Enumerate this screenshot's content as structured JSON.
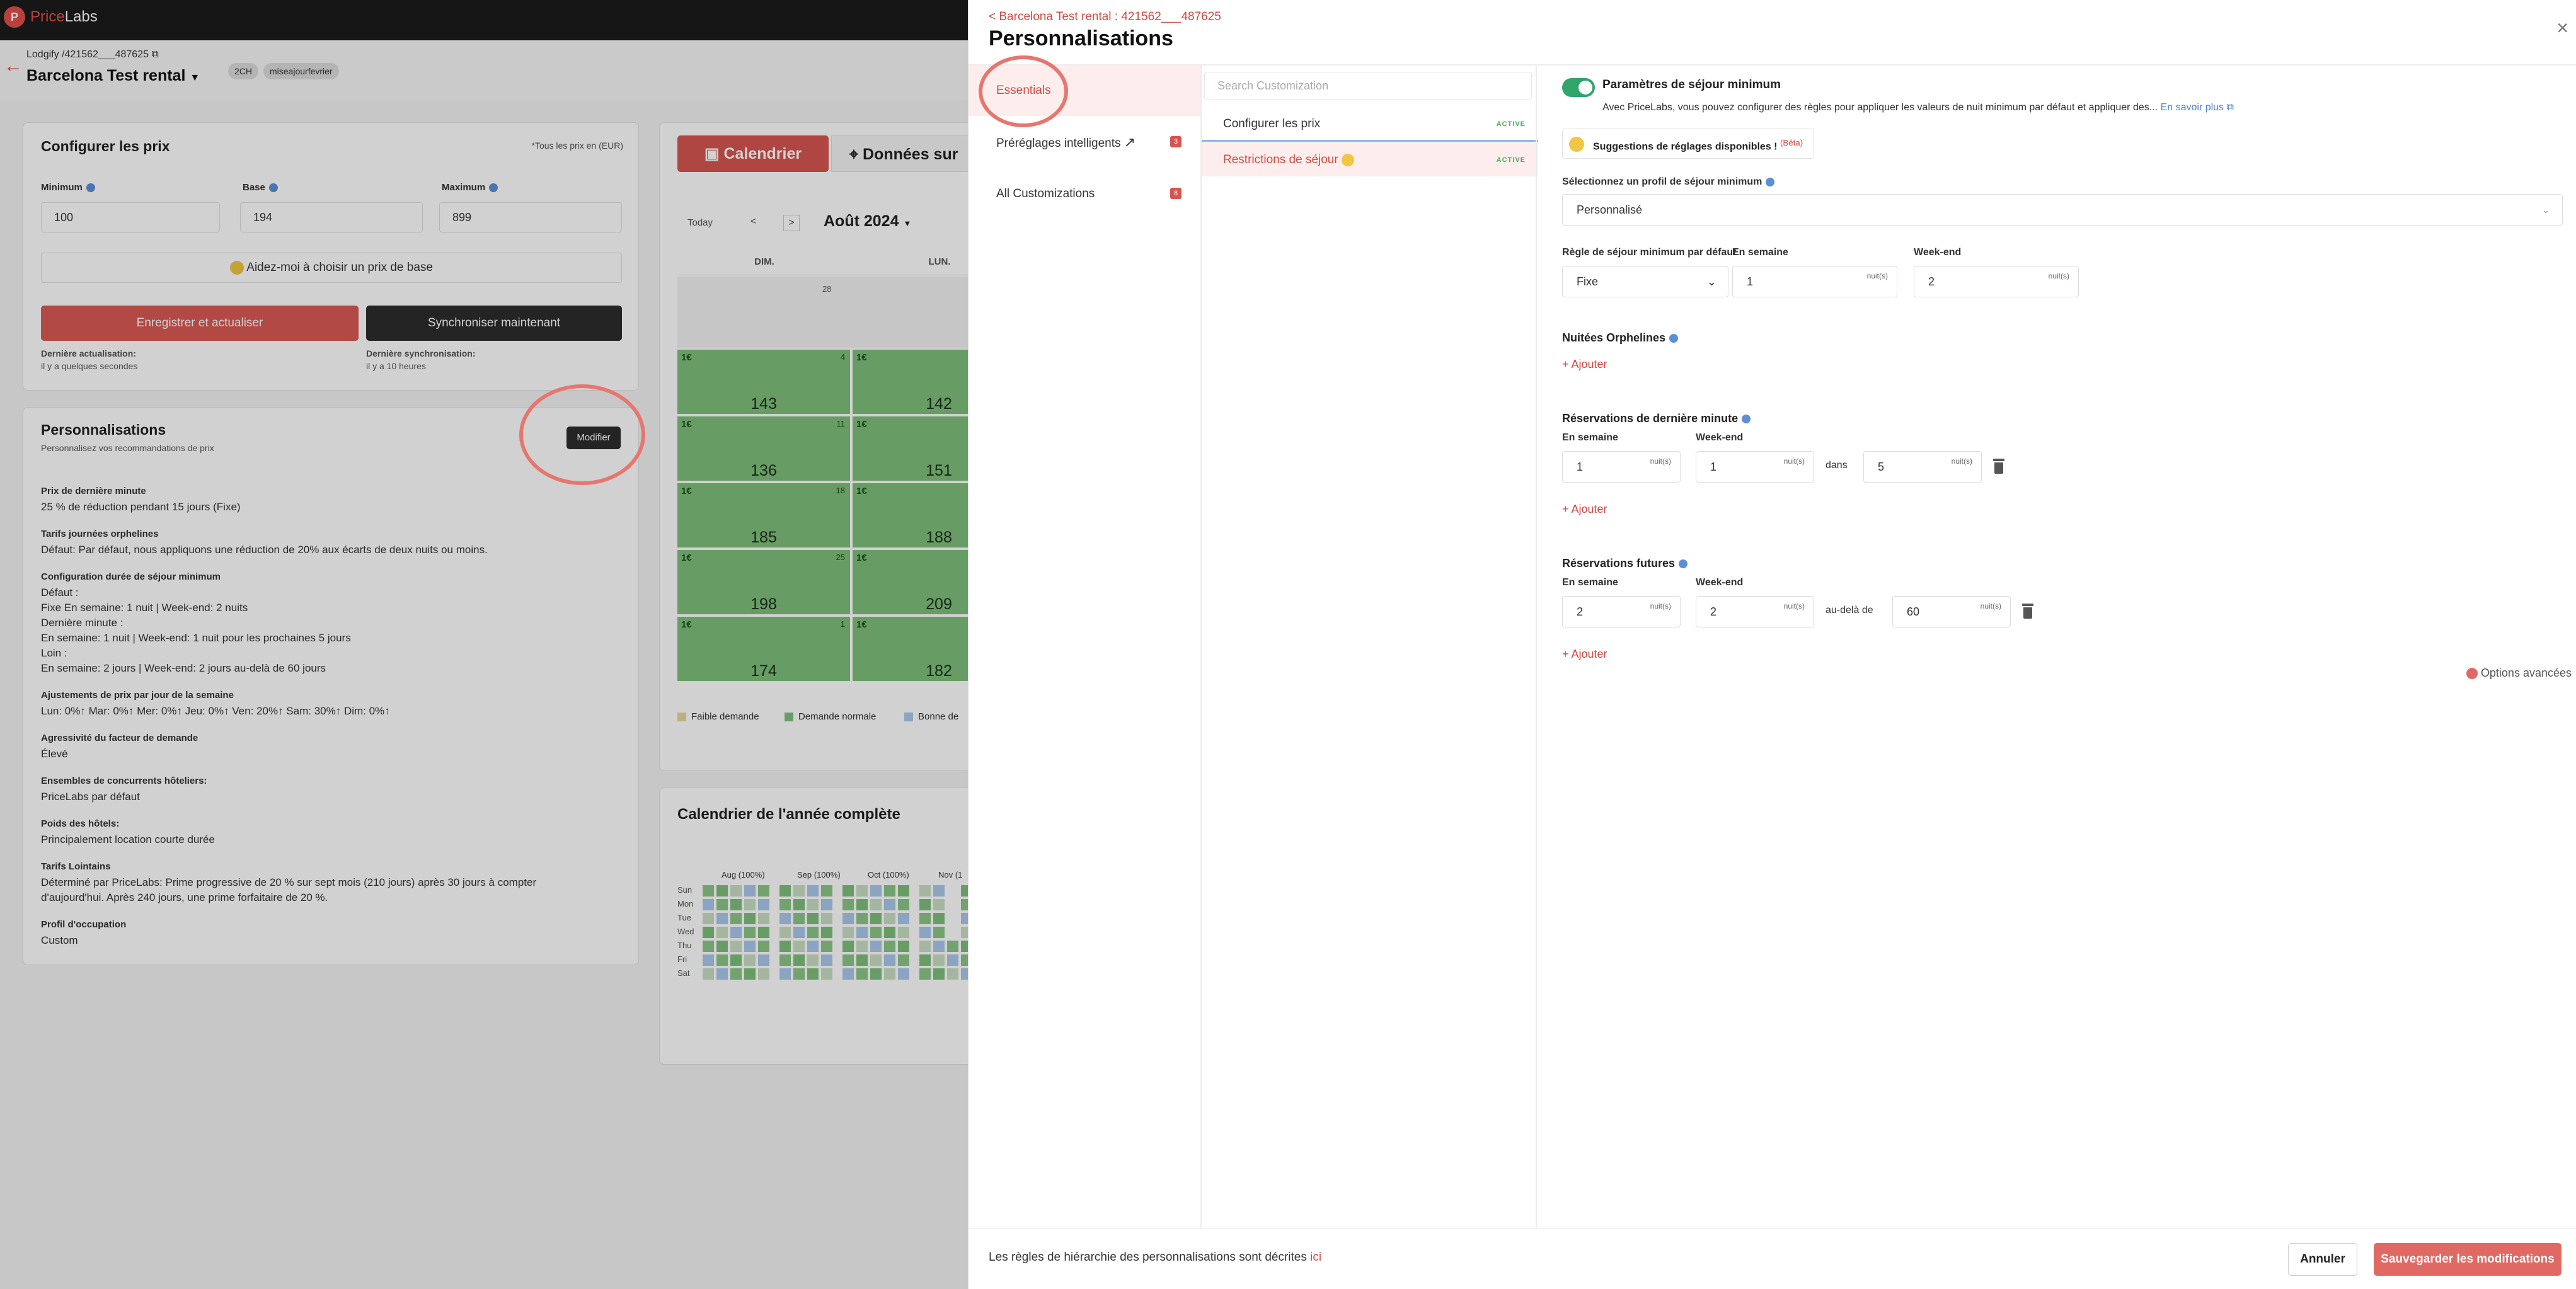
{
  "app": {
    "logo_letter": "P",
    "logo_part1": "Price",
    "logo_part2": "Labs",
    "account": "Lodgify /421562___487625",
    "listing_name": "Barcelona Test rental",
    "tags": [
      "2CH",
      "miseajourfevrier"
    ]
  },
  "pricing_card": {
    "title": "Configurer les prix",
    "note": "*Tous les prix en (EUR)",
    "min_label": "Minimum",
    "min_value": "100",
    "base_label": "Base",
    "base_value": "194",
    "max_label": "Maximum",
    "max_value": "899",
    "help_button": "Aidez-moi à choisir un prix de base",
    "save_button": "Enregistrer et actualiser",
    "sync_button": "Synchroniser maintenant",
    "last_update_label": "Dernière actualisation:",
    "last_update_value": "il y a quelques secondes",
    "last_sync_label": "Dernière synchronisation:",
    "last_sync_value": "il y a 10 heures"
  },
  "perso_card": {
    "title": "Personnalisations",
    "subtitle": "Personnalisez vos recommandations de prix",
    "edit_button": "Modifier",
    "items": [
      {
        "label": "Prix de dernière minute",
        "lines": [
          "25 % de réduction pendant 15 jours (Fixe)"
        ]
      },
      {
        "label": "Tarifs journées orphelines",
        "lines": [
          "Défaut: Par défaut, nous appliquons une réduction de 20% aux écarts de deux nuits ou moins."
        ]
      },
      {
        "label": "Configuration durée de séjour minimum",
        "lines": [
          "Défaut :",
          "Fixe En semaine: 1 nuit | Week-end: 2 nuits",
          "Dernière minute :",
          "En semaine: 1 nuit | Week-end: 1 nuit pour les prochaines 5 jours",
          "Loin :",
          "En semaine: 2 jours | Week-end: 2 jours au-delà de 60 jours"
        ]
      },
      {
        "label": "Ajustements de prix par jour de la semaine",
        "lines": [
          "Lun: 0%↑ Mar: 0%↑ Mer: 0%↑ Jeu: 0%↑ Ven: 20%↑ Sam: 30%↑ Dim: 0%↑"
        ]
      },
      {
        "label": "Agressivité du facteur de demande",
        "lines": [
          "Élevé"
        ]
      },
      {
        "label": "Ensembles de concurrents hôteliers:",
        "lines": [
          "PriceLabs par défaut"
        ]
      },
      {
        "label": "Poids des hôtels:",
        "lines": [
          "Principalement location courte durée"
        ]
      },
      {
        "label": "Tarifs Lointains",
        "lines": [
          "Déterminé par PriceLabs: Prime progressive de 20 % sur sept mois (210 jours) après 30 jours à compter",
          "d'aujourd'hui. Après 240 jours, une prime forfaitaire de 20 %."
        ]
      },
      {
        "label": "Profil d'occupation",
        "lines": [
          "Custom"
        ]
      }
    ]
  },
  "calendar": {
    "tab_calendar": "Calendrier",
    "tab_market": "Données sur",
    "today": "Today",
    "prev": "<",
    "next": ">",
    "month": "Août 2024",
    "col1": "DIM.",
    "col2": "LUN.",
    "currency_symbol": "1€",
    "rows": [
      {
        "d1": "4",
        "p1": "143",
        "d2": "",
        "p2": "142"
      },
      {
        "d1": "11",
        "p1": "136",
        "d2": "",
        "p2": "151"
      },
      {
        "d1": "18",
        "p1": "185",
        "d2": "",
        "p2": "188"
      },
      {
        "d1": "25",
        "p1": "198",
        "d2": "",
        "p2": "209"
      },
      {
        "d1": "1",
        "p1": "174",
        "d2": "",
        "p2": "182"
      }
    ],
    "prev_day": "28",
    "legend": [
      "Faible demande",
      "Demande normale",
      "Bonne de"
    ],
    "legend_colors": [
      "#e6d89a",
      "#7ec07a",
      "#a9c9ec"
    ]
  },
  "year_calendar": {
    "title": "Calendrier de l'année complète",
    "months": [
      "Aug (100%)",
      "Sep (100%)",
      "Oct (100%)",
      "Nov (1"
    ],
    "days": [
      "Sun",
      "Mon",
      "Tue",
      "Wed",
      "Thu",
      "Fri",
      "Sat"
    ]
  },
  "drawer": {
    "breadcrumb": "< Barcelona Test rental : 421562___487625",
    "title": "Personnalisations",
    "close": "×",
    "nav": [
      {
        "label": "Essentials",
        "badge": ""
      },
      {
        "label": "Préréglages intelligents",
        "badge": "3"
      },
      {
        "label": "All Customizations",
        "badge": "8"
      }
    ],
    "search_placeholder": "Search Customization",
    "customizations": [
      {
        "label": "Configurer les prix",
        "status": "ACTIVE"
      },
      {
        "label": "Restrictions de séjour",
        "status": "ACTIVE"
      }
    ],
    "panel": {
      "title": "Paramètres de séjour minimum",
      "desc": "Avec PriceLabs, vous pouvez configurer des règles pour appliquer les valeurs de nuit minimum par défaut et appliquer des...",
      "learn_more": "En savoir plus",
      "suggestions": "Suggestions de réglages disponibles !",
      "beta": "(Bêta)",
      "profile_label": "Sélectionnez un profil de séjour minimum",
      "profile_value": "Personnalisé",
      "default_rule_label": "Règle de séjour minimum par défaut",
      "weekday_label": "En semaine",
      "weekend_label": "Week-end",
      "default_rule_value": "Fixe",
      "default_weekday": "1",
      "default_weekend": "2",
      "unit": "nuit(s)",
      "orphan_title": "Nuitées Orphelines",
      "add": "+ Ajouter",
      "lastminute_title": "Réservations de dernière minute",
      "lm_weekday": "1",
      "lm_weekend": "1",
      "lm_within": "dans",
      "lm_days": "5",
      "future_title": "Réservations futures",
      "fut_weekday": "2",
      "fut_weekend": "2",
      "fut_beyond": "au-delà de",
      "fut_days": "60",
      "advanced": "Options avancées"
    },
    "footer_text": "Les règles de hiérarchie des personnalisations sont décrites",
    "footer_link": "ici",
    "cancel": "Annuler",
    "save": "Sauvegarder les modifications"
  }
}
